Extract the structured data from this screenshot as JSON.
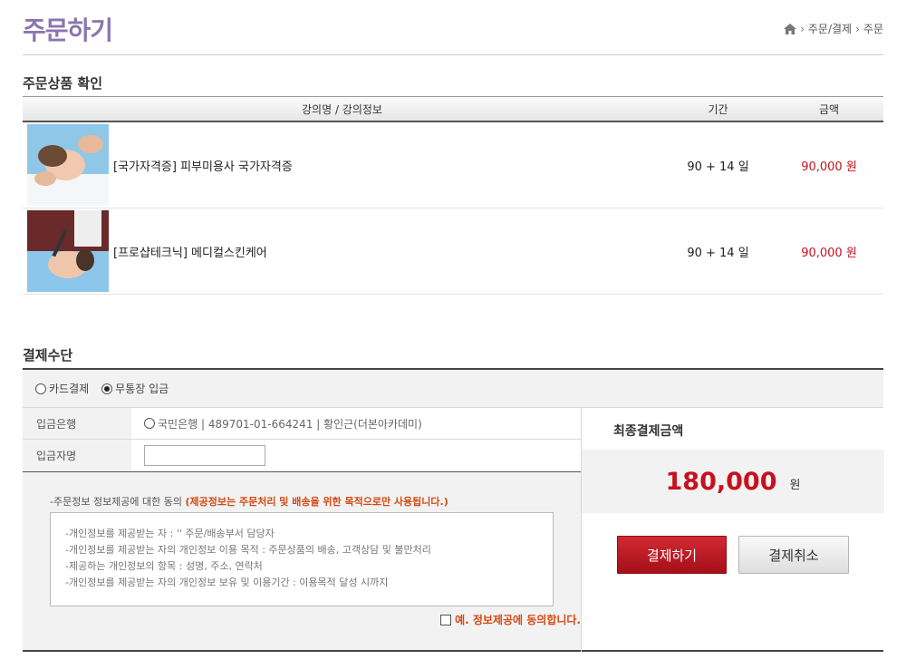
{
  "header": {
    "title": "주문하기",
    "breadcrumb": [
      "주문/결제",
      "주문"
    ]
  },
  "order_section": {
    "title": "주문상품 확인",
    "columns": [
      "강의명 / 강의정보",
      "기간",
      "금액"
    ],
    "rows": [
      {
        "name": "[국가자격증] 피부미용사 국가자격증",
        "period": "90 + 14 일",
        "price": "90,000 원"
      },
      {
        "name": "[프로샵테크닉] 메디컬스킨케어",
        "period": "90 + 14 일",
        "price": "90,000 원"
      }
    ]
  },
  "payment_section": {
    "title": "결제수단",
    "methods": [
      {
        "label": "카드결제",
        "selected": false
      },
      {
        "label": "무통장 입금",
        "selected": true
      }
    ],
    "bank_label": "입금은행",
    "bank_value": "국민은행 | 489701-01-664241 | 황인근(더본아카데미)",
    "depositor_label": "입금자명",
    "depositor_value": "",
    "consent_title": "-주문정보 정보제공에 대한 동의 ",
    "consent_warning": "(제공정보는 주문처리 및 배송을 위한 목적으로만 사용됩니다.)",
    "consent_lines": [
      "-개인정보를 제공받는 자 : '' 주문/배송부서 담당자",
      "-개인정보를 제공받는 자의 개인정보 이용 목적 : 주문상품의 배송, 고객상담 및 불만처리",
      "-제공하는 개인정보의 항목 : 성명, 주소, 연락처",
      "-개인정보를 제공받는 자의 개인정보 보유 및 이용기간 : 이용목적 달성 시까지"
    ],
    "agree_label": "예. 정보제공에 동의합니다.",
    "total_label": "최종결제금액",
    "total_amount": "180,000",
    "total_unit": "원",
    "pay_button": "결제하기",
    "cancel_button": "결제취소"
  },
  "colors": {
    "title_purple": "#8a76b0",
    "price_red": "#c8101e",
    "warning_orange": "#d24a12"
  }
}
